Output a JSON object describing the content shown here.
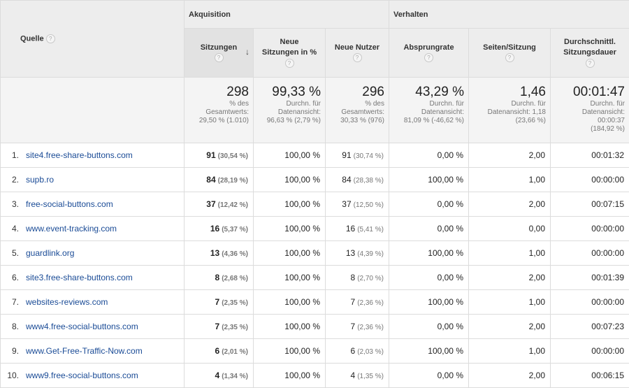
{
  "groups": {
    "acquisition": "Akquisition",
    "behavior": "Verhalten"
  },
  "columns": {
    "source": "Quelle",
    "sessions": "Sitzungen",
    "new_sessions": "Neue Sitzungen in %",
    "new_users": "Neue Nutzer",
    "bounce_rate": "Absprungrate",
    "pages_session": "Seiten/Sitzung",
    "avg_duration": "Durchschnittl. Sitzungsdauer",
    "help_glyph": "?",
    "sort_glyph": "↓"
  },
  "totals": {
    "sessions": {
      "value": "298",
      "note1": "% des",
      "note2": "Gesamtwerts:",
      "note3": "29,50 % (1.010)"
    },
    "new_sessions": {
      "value": "99,33 %",
      "note1": "Durchn. für",
      "note2": "Datenansicht:",
      "note3": "96,63 % (2,79 %)"
    },
    "new_users": {
      "value": "296",
      "note1": "% des",
      "note2": "Gesamtwerts:",
      "note3": "30,33 % (976)"
    },
    "bounce_rate": {
      "value": "43,29 %",
      "note1": "Durchn. für",
      "note2": "Datenansicht:",
      "note3": "81,09 % (-46,62 %)"
    },
    "pages_session": {
      "value": "1,46",
      "note1": "Durchn. für",
      "note2": "Datenansicht: 1,18",
      "note3": "(23,66 %)"
    },
    "avg_duration": {
      "value": "00:01:47",
      "note1": "Durchn. für",
      "note2": "Datenansicht:",
      "note3": "00:00:37",
      "note4": "(184,92 %)"
    }
  },
  "rows": [
    {
      "idx": "1.",
      "source": "site4.free-share-buttons.com",
      "sessions": "91",
      "sessions_pct": "(30,54 %)",
      "new_sessions": "100,00 %",
      "new_users": "91",
      "new_users_pct": "(30,74 %)",
      "bounce": "0,00 %",
      "pages": "2,00",
      "duration": "00:01:32"
    },
    {
      "idx": "2.",
      "source": "supb.ro",
      "sessions": "84",
      "sessions_pct": "(28,19 %)",
      "new_sessions": "100,00 %",
      "new_users": "84",
      "new_users_pct": "(28,38 %)",
      "bounce": "100,00 %",
      "pages": "1,00",
      "duration": "00:00:00"
    },
    {
      "idx": "3.",
      "source": "free-social-buttons.com",
      "sessions": "37",
      "sessions_pct": "(12,42 %)",
      "new_sessions": "100,00 %",
      "new_users": "37",
      "new_users_pct": "(12,50 %)",
      "bounce": "0,00 %",
      "pages": "2,00",
      "duration": "00:07:15"
    },
    {
      "idx": "4.",
      "source": "www.event-tracking.com",
      "sessions": "16",
      "sessions_pct": "(5,37 %)",
      "new_sessions": "100,00 %",
      "new_users": "16",
      "new_users_pct": "(5,41 %)",
      "bounce": "0,00 %",
      "pages": "0,00",
      "duration": "00:00:00"
    },
    {
      "idx": "5.",
      "source": "guardlink.org",
      "sessions": "13",
      "sessions_pct": "(4,36 %)",
      "new_sessions": "100,00 %",
      "new_users": "13",
      "new_users_pct": "(4,39 %)",
      "bounce": "100,00 %",
      "pages": "1,00",
      "duration": "00:00:00"
    },
    {
      "idx": "6.",
      "source": "site3.free-share-buttons.com",
      "sessions": "8",
      "sessions_pct": "(2,68 %)",
      "new_sessions": "100,00 %",
      "new_users": "8",
      "new_users_pct": "(2,70 %)",
      "bounce": "0,00 %",
      "pages": "2,00",
      "duration": "00:01:39"
    },
    {
      "idx": "7.",
      "source": "websites-reviews.com",
      "sessions": "7",
      "sessions_pct": "(2,35 %)",
      "new_sessions": "100,00 %",
      "new_users": "7",
      "new_users_pct": "(2,36 %)",
      "bounce": "100,00 %",
      "pages": "1,00",
      "duration": "00:00:00"
    },
    {
      "idx": "8.",
      "source": "www4.free-social-buttons.com",
      "sessions": "7",
      "sessions_pct": "(2,35 %)",
      "new_sessions": "100,00 %",
      "new_users": "7",
      "new_users_pct": "(2,36 %)",
      "bounce": "0,00 %",
      "pages": "2,00",
      "duration": "00:07:23"
    },
    {
      "idx": "9.",
      "source": "www.Get-Free-Traffic-Now.com",
      "sessions": "6",
      "sessions_pct": "(2,01 %)",
      "new_sessions": "100,00 %",
      "new_users": "6",
      "new_users_pct": "(2,03 %)",
      "bounce": "100,00 %",
      "pages": "1,00",
      "duration": "00:00:00"
    },
    {
      "idx": "10.",
      "source": "www9.free-social-buttons.com",
      "sessions": "4",
      "sessions_pct": "(1,34 %)",
      "new_sessions": "100,00 %",
      "new_users": "4",
      "new_users_pct": "(1,35 %)",
      "bounce": "0,00 %",
      "pages": "2,00",
      "duration": "00:06:15"
    }
  ]
}
